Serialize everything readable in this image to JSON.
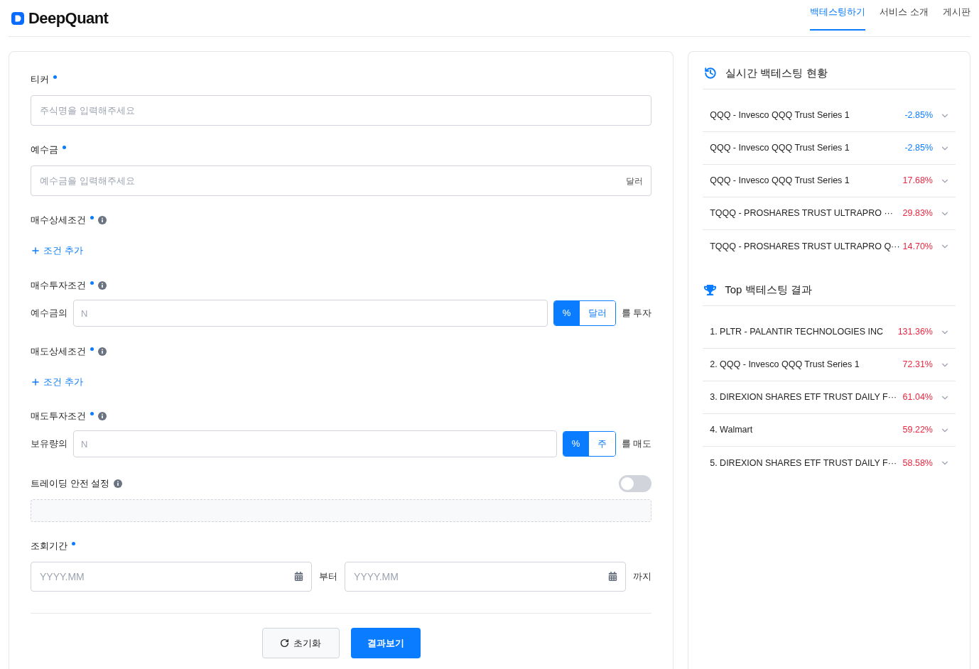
{
  "brand": {
    "name": "DeepQuant"
  },
  "nav": [
    {
      "label": "백테스팅하기",
      "selected": true
    },
    {
      "label": "서비스 소개",
      "selected": false
    },
    {
      "label": "게시판",
      "selected": false
    }
  ],
  "form": {
    "ticker": {
      "label": "티커",
      "required": true,
      "placeholder": "주식명을 입력해주세요"
    },
    "deposit": {
      "label": "예수금",
      "required": true,
      "placeholder": "예수금을 입력해주세요",
      "unit": "달러"
    },
    "buy_conditions": {
      "label": "매수상세조건",
      "required": true,
      "add": "조건 추가"
    },
    "buy_invest": {
      "label": "매수투자조건",
      "required": true,
      "prefix": "예수금의",
      "placeholder": "N",
      "units": [
        {
          "label": "%",
          "selected": true
        },
        {
          "label": "달러",
          "selected": false
        }
      ],
      "suffix": "를 투자"
    },
    "sell_conditions": {
      "label": "매도상세조건",
      "required": true,
      "add": "조건 추가"
    },
    "sell_invest": {
      "label": "매도투자조건",
      "required": true,
      "prefix": "보유량의",
      "placeholder": "N",
      "units": [
        {
          "label": "%",
          "selected": true
        },
        {
          "label": "주",
          "selected": false
        }
      ],
      "suffix": "를 매도"
    },
    "safety": {
      "label": "트레이딩 안전 설정",
      "on": false
    },
    "period": {
      "label": "조회기간",
      "required": true,
      "from_placeholder": "YYYY.MM",
      "from_suffix": "부터",
      "to_placeholder": "YYYY.MM",
      "to_suffix": "까지"
    },
    "reset_button": "초기화",
    "submit_button": "결과보기"
  },
  "panels": [
    {
      "kind": "history",
      "title": "실시간 백테스팅 현황",
      "items": [
        {
          "name": "QQQ - Invesco QQQ Trust Series 1",
          "return": "-2.85%",
          "color": "#0a7cff"
        },
        {
          "name": "QQQ - Invesco QQQ Trust Series 1",
          "return": "-2.85%",
          "color": "#0a7cff"
        },
        {
          "name": "QQQ - Invesco QQQ Trust Series 1",
          "return": "17.68%",
          "color": "#e8263f"
        },
        {
          "name": "TQQQ - PROSHARES TRUST ULTRAPRO ···",
          "return": "29.83%",
          "color": "#e8263f"
        },
        {
          "name": "TQQQ - PROSHARES TRUST ULTRAPRO Q···",
          "return": "14.70%",
          "color": "#e8263f"
        }
      ]
    },
    {
      "kind": "trophy",
      "title": "Top 백테스팅 결과",
      "items": [
        {
          "name": "1. PLTR - PALANTIR TECHNOLOGIES INC",
          "return": "131.36%",
          "color": "#e8263f"
        },
        {
          "name": "2. QQQ - Invesco QQQ Trust Series 1",
          "return": "72.31%",
          "color": "#e8263f"
        },
        {
          "name": "3. DIREXION SHARES ETF TRUST DAILY F···",
          "return": "61.04%",
          "color": "#e8263f"
        },
        {
          "name": "4. Walmart",
          "return": "59.22%",
          "color": "#e8263f"
        },
        {
          "name": "5. DIREXION SHARES ETF TRUST DAILY F···",
          "return": "58.58%",
          "color": "#e8263f"
        }
      ]
    }
  ]
}
